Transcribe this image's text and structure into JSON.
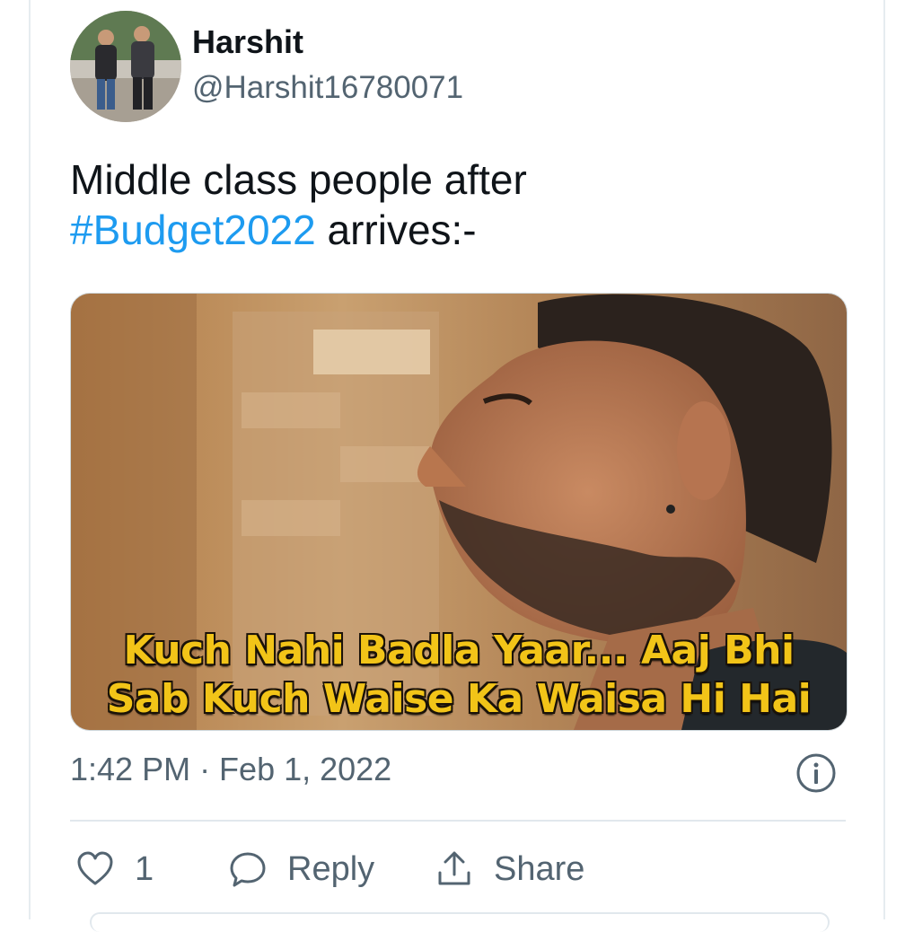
{
  "author": {
    "name": "Harshit",
    "handle": "@Harshit16780071"
  },
  "tweet": {
    "text_before": "Middle class people after",
    "hashtag": "#Budget2022",
    "text_after": " arrives:-"
  },
  "media": {
    "caption_line1": "Kuch Nahi Badla Yaar... Aaj Bhi",
    "caption_line2": "Sab Kuch Waise Ka Waisa Hi Hai"
  },
  "timestamp": "1:42 PM · Feb 1, 2022",
  "actions": {
    "like_count": "1",
    "reply_label": "Reply",
    "share_label": "Share"
  },
  "colors": {
    "accent": "#1d9bf0",
    "secondary_text": "#536471",
    "caption_yellow": "#f2c418"
  },
  "icons": [
    "info-icon",
    "heart-icon",
    "reply-bubble-icon",
    "share-icon"
  ]
}
